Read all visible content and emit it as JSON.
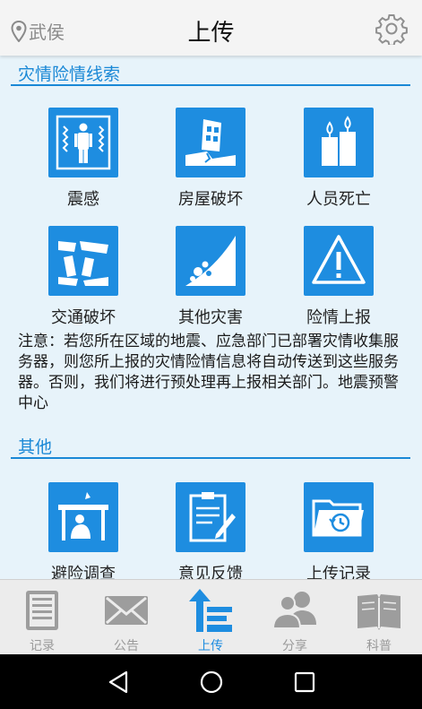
{
  "header": {
    "location": "武侯",
    "title": "上传"
  },
  "sections": {
    "clues": {
      "title": "灾情险情线索"
    },
    "other": {
      "title": "其他"
    }
  },
  "tiles": {
    "earthquake": "震感",
    "house": "房屋破坏",
    "casualty": "人员死亡",
    "traffic": "交通破坏",
    "other_disaster": "其他灾害",
    "danger": "险情上报",
    "refuge": "避险调查",
    "feedback": "意见反馈",
    "upload_log": "上传记录"
  },
  "notice": "注意：若您所在区域的地震、应急部门已部署灾情收集服务器，则您所上报的灾情险情信息将自动传送到这些服务器。否则，我们将进行预处理再上报相关部门。地震预警中心",
  "tabs": {
    "record": "记录",
    "announce": "公告",
    "upload": "上传",
    "share": "分享",
    "science": "科普"
  },
  "colors": {
    "accent": "#1e8de0",
    "background": "#e7f3fa",
    "inactive_tab": "#9a9a9a"
  }
}
